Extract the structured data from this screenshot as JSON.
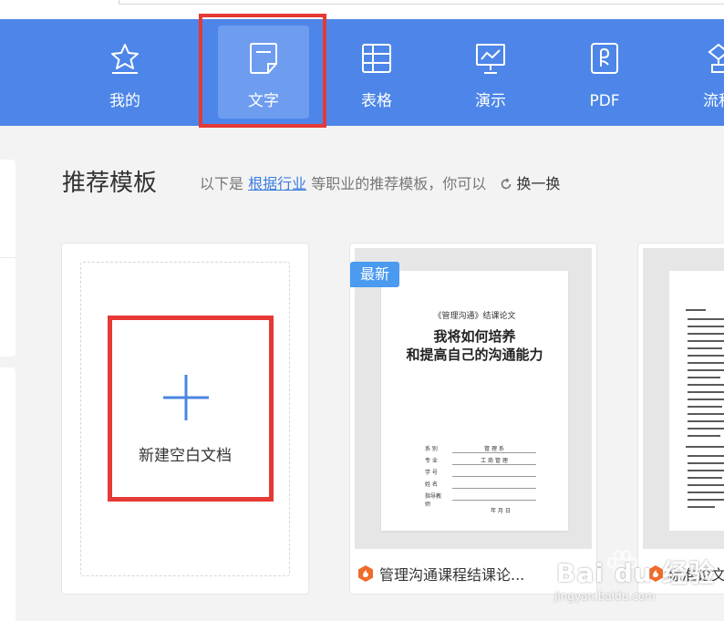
{
  "nav": {
    "items": [
      {
        "label": "我的",
        "icon": "star-icon"
      },
      {
        "label": "文字",
        "icon": "document-icon"
      },
      {
        "label": "表格",
        "icon": "table-icon"
      },
      {
        "label": "演示",
        "icon": "presentation-icon"
      },
      {
        "label": "PDF",
        "icon": "pdf-icon"
      },
      {
        "label": "流程",
        "icon": "flowchart-icon"
      }
    ],
    "active": "文字"
  },
  "section": {
    "title": "推荐模板",
    "subtitle_prefix": "以下是",
    "subtitle_link": "根据行业",
    "subtitle_suffix": "等职业的推荐模板，你可以",
    "refresh_label": "换一换"
  },
  "cards": {
    "blank": {
      "label": "新建空白文档"
    },
    "doc1": {
      "badge": "最新",
      "paper_top": "《管理沟通》结课论文",
      "paper_title_1": "我将如何培养",
      "paper_title_2": "和提高自己的沟通能力",
      "fields": [
        {
          "k": "系  别",
          "v": "管 理 系"
        },
        {
          "k": "专  业",
          "v": "工 商 管 理"
        },
        {
          "k": "学  号",
          "v": ""
        },
        {
          "k": "姓  名",
          "v": ""
        },
        {
          "k": "指导教师",
          "v": ""
        }
      ],
      "paper_date": "年   月   日",
      "footer": "管理沟通课程结课论..."
    },
    "doc2": {
      "footer": "标准论文"
    }
  },
  "watermark": {
    "brand": "Bai du 经验",
    "url": "jingyan.baidu.com"
  },
  "colors": {
    "nav_bg": "#4d86e8",
    "nav_active": "#6e9df0",
    "highlight": "#e53935",
    "link": "#3b7de0",
    "badge": "#4a9af0"
  }
}
